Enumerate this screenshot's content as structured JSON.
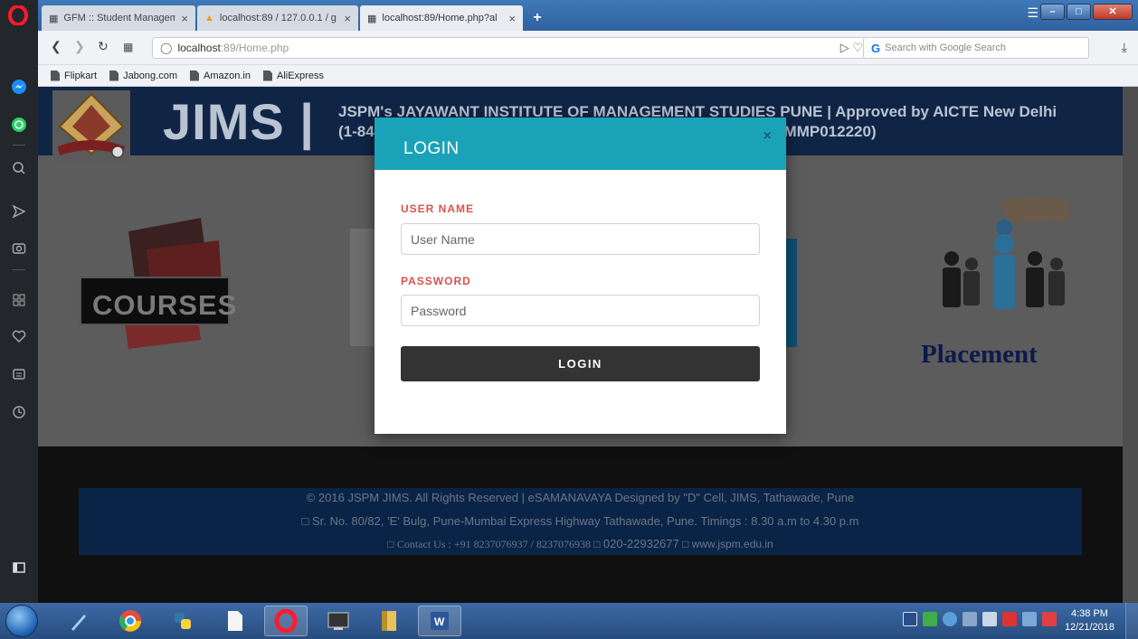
{
  "browser": {
    "tabs": [
      {
        "title": "GFM :: Student Manageme"
      },
      {
        "title": "localhost:89 / 127.0.0.1 / g"
      },
      {
        "title": "localhost:89/Home.php?al"
      }
    ],
    "url_host": "localhost",
    "url_rest": ":89/Home.php",
    "search_placeholder": "Search with Google Search",
    "bookmarks": [
      "Flipkart",
      "Jabong.com",
      "Amazon.in",
      "AliExpress"
    ]
  },
  "site": {
    "brand": "JIMS |",
    "header_line1": "JSPM's JAYAWANT INSTITUTE OF MANAGEMENT STUDIES PUNE | Approved by AICTE New Delhi",
    "header_line2": "(1-84",
    "header_line2_tail": "y (IMMP012220)",
    "courses_label": "COURSES",
    "placement_label": "Placement"
  },
  "modal": {
    "title": "LOGIN",
    "close": "×",
    "username_label": "USER NAME",
    "username_placeholder": "User Name",
    "password_label": "PASSWORD",
    "password_placeholder": "Password",
    "submit": "LOGIN"
  },
  "footer": {
    "line1": "© 2016 JSPM JIMS. All Rights Reserved | eSAMANAVAYA Designed by \"D\" Cell, JIMS, Tathawade, Pune",
    "line2": "Sr. No. 80/82, 'E' Bulg, Pune-Mumbai Express Highway Tathawade, Pune.  Timings : 8.30 a.m to 4.30 p.m",
    "line3_contact": "Contact Us : +91 8237076937 / 8237076938",
    "line3_phone": "020-22932677",
    "line3_web": "www.jspm.edu.in"
  },
  "taskbar": {
    "time": "4:38 PM",
    "date": "12/21/2018"
  },
  "colors": {
    "modal_header": "#1aa3b8",
    "label_red": "#d9534f",
    "login_button": "#333333",
    "site_header": "#102546"
  }
}
